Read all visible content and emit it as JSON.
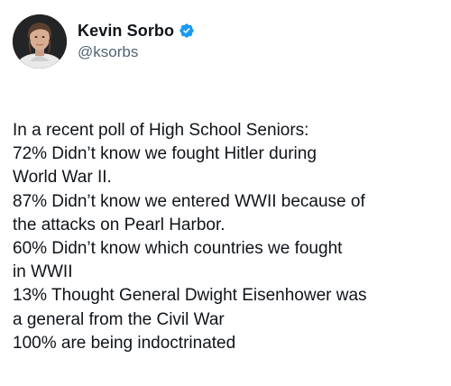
{
  "post": {
    "author": {
      "display_name": "Kevin Sorbo",
      "handle": "@ksorbs",
      "verified": true,
      "avatar_icon": "profile-photo",
      "verified_icon": "verified-badge-icon",
      "verified_color": "#1d9bf0"
    },
    "lines": [
      "In a recent poll of High School Seniors:",
      "72% Didn’t know we fought Hitler during",
      "World War II.",
      "87% Didn’t know we entered WWII because of",
      "the attacks on Pearl Harbor.",
      "60% Didn’t know which countries we fought",
      "in WWII",
      "13% Thought General Dwight Eisenhower was",
      "a general from the Civil War",
      "100%  are being indoctrinated"
    ]
  }
}
